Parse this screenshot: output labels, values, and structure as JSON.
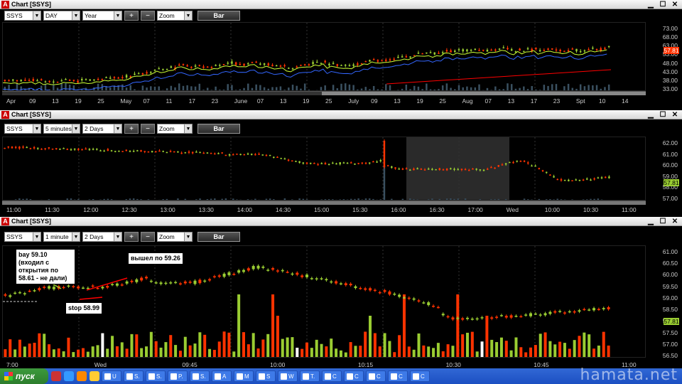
{
  "windows": [
    {
      "title": "Chart [SSYS]",
      "symbol": "SSYS",
      "period": "DAY",
      "range": "Year",
      "zoom": "Zoom",
      "bar": "Bar",
      "last_price": "57.81",
      "y_labels": [
        "73.00",
        "68.00",
        "63.00",
        "53.00",
        "48.00",
        "43.00",
        "38.00",
        "33.00"
      ],
      "x_labels": [
        "Apr",
        "09",
        "13",
        "19",
        "25",
        "May",
        "07",
        "11",
        "17",
        "23",
        "June",
        "07",
        "13",
        "19",
        "25",
        "July",
        "09",
        "13",
        "19",
        "25",
        "Aug",
        "07",
        "13",
        "17",
        "23",
        "Spt",
        "10",
        "14"
      ]
    },
    {
      "title": "Chart [SSYS]",
      "symbol": "SSYS",
      "period": "5 minutes",
      "range": "2 Days",
      "zoom": "Zoom",
      "bar": "Bar",
      "last_price": "57.81",
      "y_labels": [
        "62.00",
        "61.00",
        "60.00",
        "59.00",
        "58.00",
        "57.00"
      ],
      "x_labels": [
        "11:00",
        "11:30",
        "12:00",
        "12:30",
        "13:00",
        "13:30",
        "14:00",
        "14:30",
        "15:00",
        "15:30",
        "16:00",
        "16:30",
        "17:00",
        "Wed",
        "10:00",
        "10:30",
        "11:00"
      ]
    },
    {
      "title": "Chart [SSYS]",
      "symbol": "SSYS",
      "period": "1 minute",
      "range": "2 Days",
      "zoom": "Zoom",
      "bar": "Bar",
      "last_price": "57.81",
      "y_labels": [
        "61.00",
        "60.50",
        "60.00",
        "59.50",
        "59.00",
        "58.50",
        "58.00",
        "57.50",
        "57.00",
        "56.50"
      ],
      "x_labels": [
        "7:00",
        "Wed",
        "09:45",
        "10:00",
        "10:15",
        "10:30",
        "10:45",
        "11:00"
      ]
    }
  ],
  "annotations": {
    "buy": "bay 59.10 (входил с открытия по 58.61 - не дали)",
    "exit": "вышел по 59.26",
    "stop": "stop 58.99"
  },
  "taskbar": {
    "start": "пуск",
    "tasks": [
      "U",
      "S.",
      "S.",
      "P.",
      "S.",
      "A",
      "M",
      "S",
      "W",
      "T.",
      "C",
      "C",
      "C",
      "C",
      "C"
    ]
  },
  "watermark": "hamata.net",
  "colors": {
    "up": "#9acd32",
    "down": "#ff3300",
    "ma_yellow": "#ccff33",
    "ma_blue": "#3366ff",
    "ma_red": "#ff0000"
  }
}
